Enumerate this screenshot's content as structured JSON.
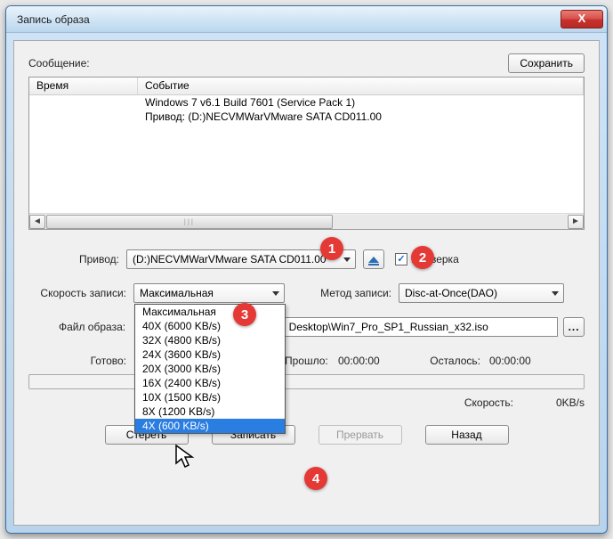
{
  "window": {
    "title": "Запись образа"
  },
  "buttons": {
    "close": "X",
    "save": "Сохранить",
    "erase": "Стереть",
    "burn": "Записать",
    "abort": "Прервать",
    "back": "Назад",
    "browse": "..."
  },
  "labels": {
    "message": "Сообщение:",
    "drive": "Привод:",
    "verify": "Проверка",
    "write_speed": "Скорость записи:",
    "write_method": "Метод записи:",
    "image_file": "Файл образа:",
    "ready": "Готово:",
    "elapsed": "Прошло:",
    "remaining": "Осталось:",
    "rate": "Скорость:"
  },
  "log": {
    "col_time": "Время",
    "col_event": "Событие",
    "rows": [
      {
        "time": "",
        "event": "Windows 7 v6.1 Build 7601 (Service Pack 1)"
      },
      {
        "time": "",
        "event": "Привод: (D:)NECVMWarVMware SATA CD011.00"
      }
    ]
  },
  "fields": {
    "drive_value": "(D:)NECVMWarVMware SATA CD011.00",
    "verify_checked": true,
    "speed_value": "Максимальная",
    "method_value": "Disc-at-Once(DAO)",
    "image_path": "Desktop\\Win7_Pro_SP1_Russian_x32.iso",
    "elapsed_time": "00:00:00",
    "remaining_time": "00:00:00",
    "rate_value": "0KB/s"
  },
  "speed_options": [
    "Максимальная",
    "40X (6000 KB/s)",
    "32X (4800 KB/s)",
    "24X (3600 KB/s)",
    "20X (3000 KB/s)",
    "16X (2400 KB/s)",
    "10X (1500 KB/s)",
    "8X (1200 KB/s)",
    "4X (600 KB/s)"
  ],
  "speed_highlight_index": 8,
  "markers": {
    "m1": "1",
    "m2": "2",
    "m3": "3",
    "m4": "4"
  }
}
